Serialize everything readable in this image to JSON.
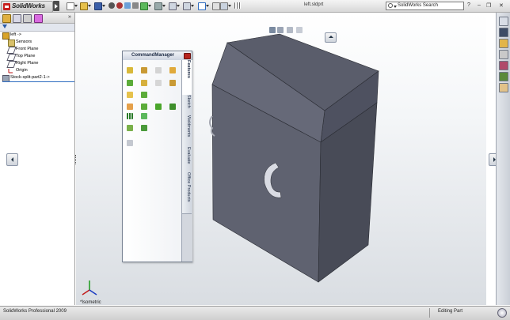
{
  "app": {
    "name": "SolidWorks",
    "document_title": "left.sldprt"
  },
  "search": {
    "placeholder": "SolidWorks Search"
  },
  "title_controls": {
    "help": "?",
    "minimize": "–",
    "restore": "❐",
    "close": "✕"
  },
  "feature_tree": {
    "more": "»",
    "items": [
      {
        "label": "left ->",
        "icon": "part-icon"
      },
      {
        "label": "Sensors",
        "icon": "sensor-icon"
      },
      {
        "label": "Front Plane",
        "icon": "plane-icon"
      },
      {
        "label": "Top Plane",
        "icon": "plane-icon"
      },
      {
        "label": "Right Plane",
        "icon": "plane-icon"
      },
      {
        "label": "Origin",
        "icon": "origin-icon"
      },
      {
        "label": "Stock-split-part2-1->",
        "icon": "stock-part-icon"
      }
    ]
  },
  "command_manager": {
    "title": "CommandManager",
    "tabs": [
      "Features",
      "Sketch",
      "Weldments",
      "Evaluate",
      "Office Products"
    ],
    "active_tab": "Features"
  },
  "viewport": {
    "view_label": "*Isometric"
  },
  "status_bar": {
    "left": "SolidWorks Professional 2009",
    "right": "Editing Part"
  },
  "colors": {
    "model_top": "#5a5d6b",
    "model_front": "#5f6270",
    "model_side": "#484b57",
    "tree_selection_line": "#2d6bc0"
  }
}
